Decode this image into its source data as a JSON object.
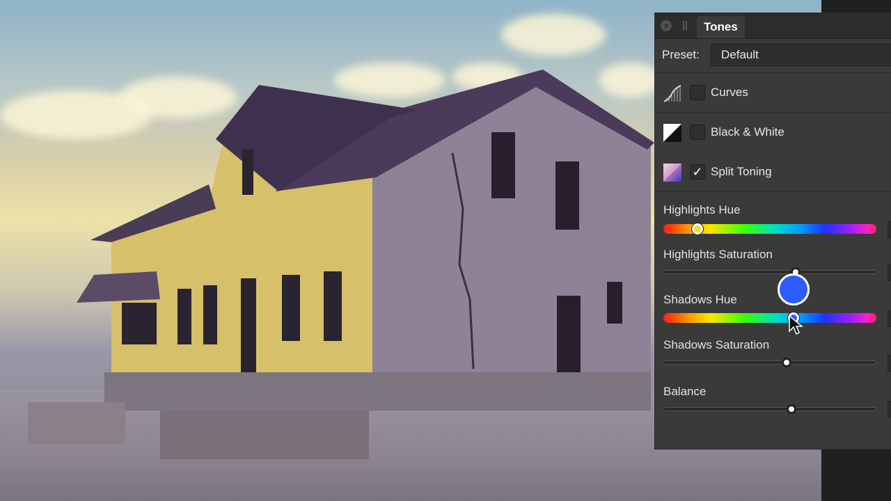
{
  "panel": {
    "tab_title": "Tones",
    "preset_label": "Preset:",
    "preset_value": "Default",
    "adjustments": [
      {
        "label": "Curves",
        "checked": false,
        "icon": "curves-icon"
      },
      {
        "label": "Black & White",
        "checked": false,
        "icon": "black-white-icon"
      },
      {
        "label": "Split Toning",
        "checked": true,
        "icon": "split-toning-icon"
      }
    ],
    "check_mark": "✓",
    "sliders": {
      "highlights_hue": {
        "label": "Highlights Hue",
        "value": 0.16
      },
      "highlights_saturation": {
        "label": "Highlights Saturation",
        "value": 0.62
      },
      "shadows_hue": {
        "label": "Shadows Hue",
        "value": 0.61,
        "color": "#2d5cff"
      },
      "shadows_saturation": {
        "label": "Shadows Saturation",
        "value": 0.58
      },
      "balance": {
        "label": "Balance",
        "value": 0.6
      }
    }
  }
}
